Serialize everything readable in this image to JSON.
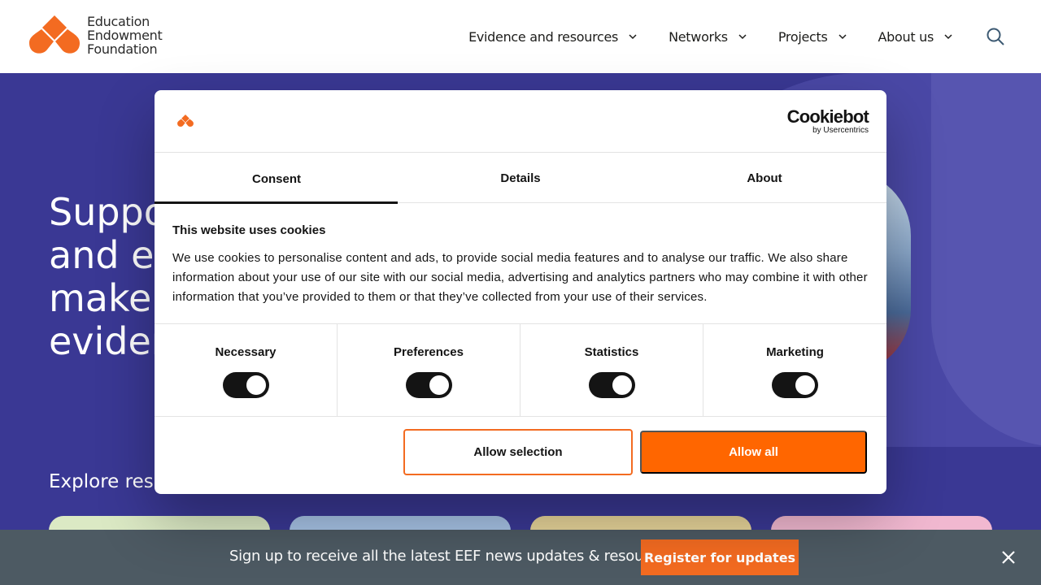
{
  "brand": {
    "lines": [
      "Education",
      "Endowment",
      "Foundation"
    ],
    "orange": "#f36b21"
  },
  "nav": {
    "items": [
      {
        "label": "Evidence and resources"
      },
      {
        "label": "Networks"
      },
      {
        "label": "Projects"
      },
      {
        "label": "About us"
      }
    ],
    "search_icon": "search-icon"
  },
  "hero": {
    "title_lines": [
      "Suppo",
      "and ea",
      "make a",
      "eviden"
    ],
    "explore": "Explore reso",
    "card_colors": [
      "#dbe9c4",
      "#a7c3e6",
      "#e8d59a",
      "#f1b8d0"
    ],
    "bg": "#3a3894"
  },
  "cookie_dialog": {
    "cookiebot_name": "Cookiebot",
    "cookiebot_by": "by Usercentrics",
    "tabs": [
      {
        "label": "Consent",
        "active": true
      },
      {
        "label": "Details",
        "active": false
      },
      {
        "label": "About",
        "active": false
      }
    ],
    "heading": "This website uses cookies",
    "body": "We use cookies to personalise content and ads, to provide social media features and to analyse our traffic. We also share information about your use of our site with our social media, advertising and analytics partners who may combine it with other information that you’ve provided to them or that they’ve collected from your use of their services.",
    "categories": [
      {
        "label": "Necessary",
        "on": true
      },
      {
        "label": "Preferences",
        "on": true
      },
      {
        "label": "Statistics",
        "on": true
      },
      {
        "label": "Marketing",
        "on": true
      }
    ],
    "allow_selection": "Allow selection",
    "allow_all": "Allow all"
  },
  "signup_bar": {
    "text": "Sign up to receive all the latest EEF news updates & resources",
    "button": "Register for updates",
    "close_icon": "close-icon"
  }
}
